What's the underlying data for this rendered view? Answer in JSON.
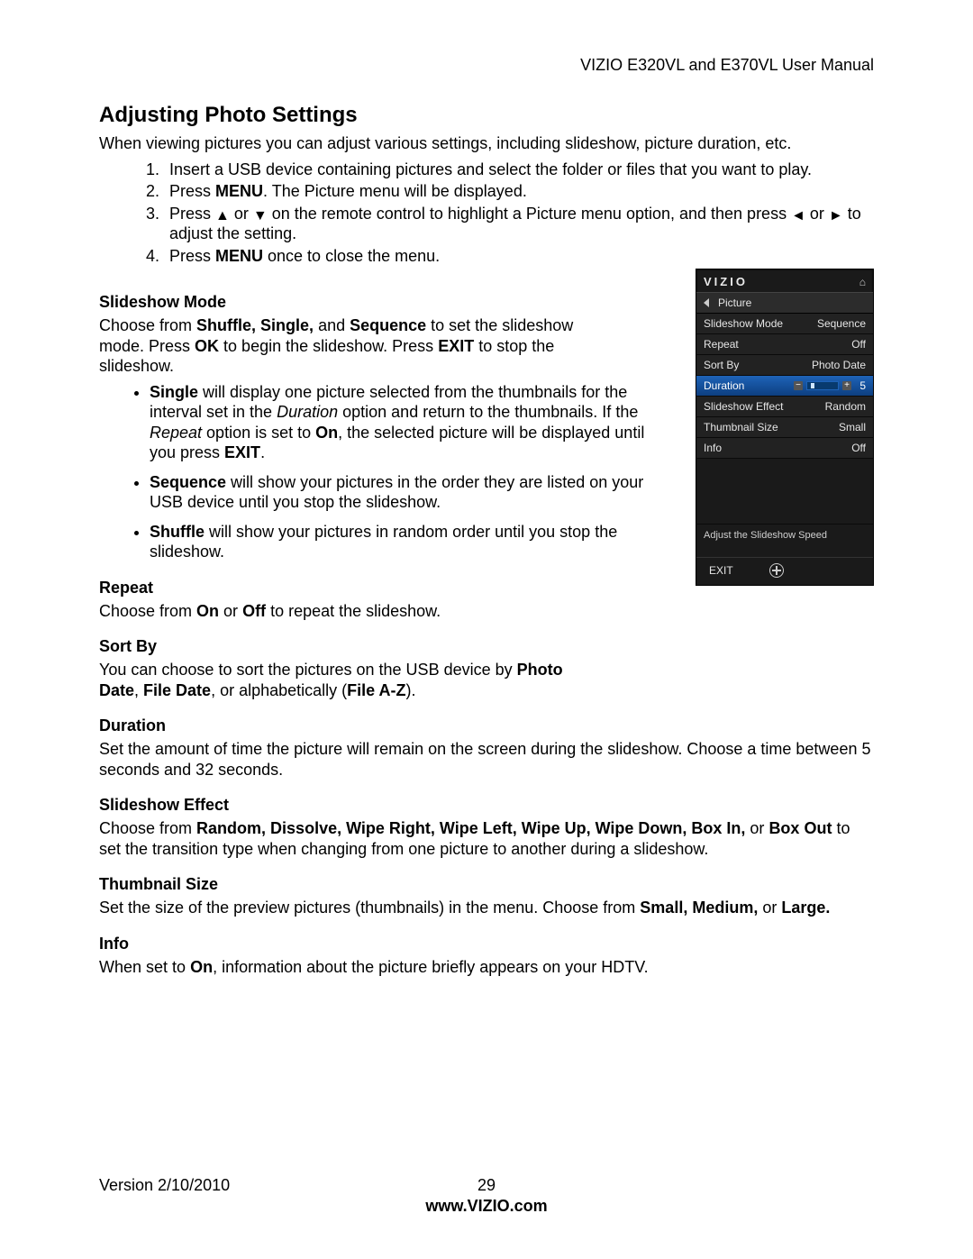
{
  "header": {
    "right": "VIZIO E320VL and E370VL User Manual"
  },
  "title": "Adjusting Photo Settings",
  "intro": "When viewing pictures you can adjust various settings, including slideshow, picture duration, etc.",
  "steps": {
    "s1": "Insert a USB device containing pictures and select the folder or files that you want to play.",
    "s2_a": "Press ",
    "s2_b": "MENU",
    "s2_c": ". The Picture menu will be displayed.",
    "s3_a": "Press ",
    "s3_b": " or ",
    "s3_c": " on the remote control to highlight a Picture menu option, and then press ",
    "s3_d": " or ",
    "s3_e": " to adjust the setting.",
    "s4_a": "Press ",
    "s4_b": "MENU",
    "s4_c": " once to close the menu."
  },
  "arrows": {
    "up": "▲",
    "down": "▼",
    "left": "◄",
    "right": "►"
  },
  "sections": {
    "slideshow_mode": {
      "title": "Slideshow Mode",
      "p1_a": "Choose from ",
      "p1_b": "Shuffle, Single,",
      "p1_c": " and ",
      "p1_d": "Sequence",
      "p1_e": " to set the slideshow mode. Press ",
      "p1_f": "OK",
      "p1_g": " to begin the slideshow. Press ",
      "p1_h": "EXIT",
      "p1_i": " to stop the slideshow.",
      "b1_a": "Single",
      "b1_b": " will display one picture selected from the thumbnails for the interval set in the ",
      "b1_c": "Duration",
      "b1_d": " option and return to the thumbnails. If the ",
      "b1_e": "Repeat",
      "b1_f": " option is set to ",
      "b1_g": "On",
      "b1_h": ", the selected picture will be displayed until you press ",
      "b1_i": "EXIT",
      "b1_j": ".",
      "b2_a": "Sequence",
      "b2_b": " will show your pictures in the order they are listed on your USB device until you stop the slideshow.",
      "b3_a": "Shuffle",
      "b3_b": " will show your pictures in random order until you stop the slideshow."
    },
    "repeat": {
      "title": "Repeat",
      "p_a": "Choose from ",
      "p_b": "On",
      "p_c": " or ",
      "p_d": "Off",
      "p_e": " to repeat the slideshow."
    },
    "sort_by": {
      "title": "Sort By",
      "p_a": "You can choose to sort the pictures on the USB device by ",
      "p_b": "Photo Date",
      "p_c": ", ",
      "p_d": "File Date",
      "p_e": ", or alphabetically (",
      "p_f": "File A-Z",
      "p_g": ")."
    },
    "duration": {
      "title": "Duration",
      "p": "Set the amount of time the picture will remain on the screen during the slideshow. Choose a time between 5 seconds and 32 seconds."
    },
    "slideshow_effect": {
      "title": "Slideshow Effect",
      "p_a": "Choose from ",
      "p_b": "Random, Dissolve, Wipe Right, Wipe Left, Wipe Up, Wipe Down, Box In,",
      "p_c": " or ",
      "p_d": "Box Out",
      "p_e": " to set the transition type when changing from one picture to another during a slideshow."
    },
    "thumbnail_size": {
      "title": "Thumbnail Size",
      "p_a": "Set the size of the preview pictures (thumbnails) in the menu. Choose from ",
      "p_b": "Small, Medium,",
      "p_c": " or ",
      "p_d": "Large."
    },
    "info": {
      "title": "Info",
      "p_a": "When set to ",
      "p_b": "On",
      "p_c": ", information about the picture briefly appears on your HDTV."
    }
  },
  "osd": {
    "brand": "VIZIO",
    "tab": "Picture",
    "rows": [
      {
        "label": "Slideshow Mode",
        "value": "Sequence"
      },
      {
        "label": "Repeat",
        "value": "Off"
      },
      {
        "label": "Sort By",
        "value": "Photo Date"
      },
      {
        "label": "Duration",
        "value": "5",
        "selected": true,
        "slider": true
      },
      {
        "label": "Slideshow Effect",
        "value": "Random"
      },
      {
        "label": "Thumbnail Size",
        "value": "Small"
      },
      {
        "label": "Info",
        "value": "Off"
      }
    ],
    "hint": "Adjust the Slideshow Speed",
    "footer_exit": "EXIT"
  },
  "footer": {
    "version": "Version 2/10/2010",
    "page": "29",
    "url": "www.VIZIO.com"
  }
}
